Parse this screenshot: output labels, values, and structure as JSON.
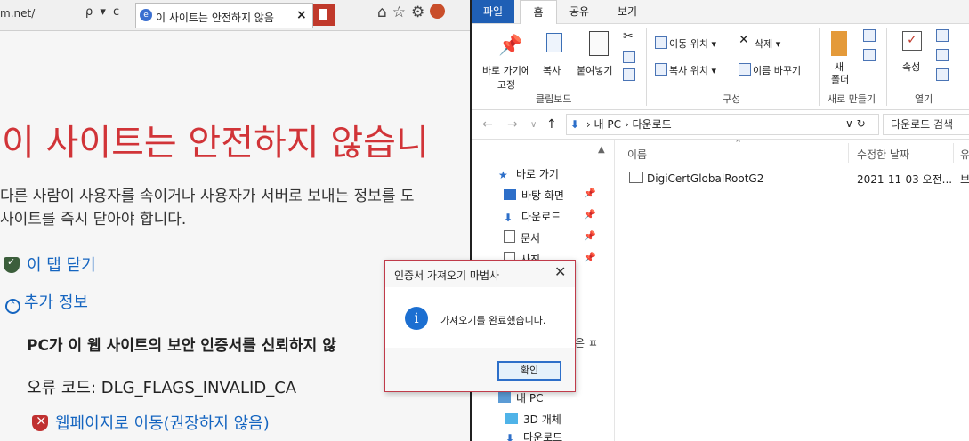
{
  "ie": {
    "url": "m.net/",
    "url_controls": "ρ ▾ c",
    "tab_title": "이 사이트는 안전하지 않음",
    "tab_close": "×",
    "tool_icons": [
      "home-icon",
      "star-icon",
      "gear-icon",
      "smiley-icon"
    ],
    "heading": "이 사이트는 안전하지 않습니",
    "desc_line1": "다른 사람이 사용자를 속이거나 사용자가 서버로 보내는 정보를 도",
    "desc_line2": "사이트를 즉시 닫아야 합니다.",
    "close_tab_link": "이 탭 닫기",
    "more_info_link": "추가 정보",
    "bold_text": "PC가 이 웹 사이트의 보안 인증서를 신뢰하지 않",
    "error_code": "오류 코드: DLG_FLAGS_INVALID_CA",
    "go_to_page_link": "웹페이지로 이동(권장하지 않음)"
  },
  "explorer": {
    "tabs": [
      "파일",
      "홈",
      "공유",
      "보기"
    ],
    "ribbon": {
      "pin_label": "바로 가기에\n고정",
      "copy": "복사",
      "paste": "붙여넣기",
      "clipboard_group": "클립보드",
      "move_to": "이동 위치 ▾",
      "copy_to": "복사 위치 ▾",
      "delete": "삭제 ▾",
      "rename": "이름 바꾸기",
      "organize_group": "구성",
      "new_folder_1": "새",
      "new_folder_2": "폴더",
      "new_group": "새로 만들기",
      "properties": "속성",
      "open_group": "열기"
    },
    "address": {
      "path_pc": "내 PC",
      "path_sep": "›",
      "path_folder": "다운로드",
      "search_placeholder": "다운로드 검색"
    },
    "nav": [
      {
        "label": "바로 가기",
        "pinned": false
      },
      {
        "label": "바탕 화면",
        "pinned": true
      },
      {
        "label": "다운로드",
        "pinned": true
      },
      {
        "label": "문서",
        "pinned": true
      },
      {
        "label": "사진",
        "pinned": true
      },
      {
        "label": "은 ㅍ",
        "pinned": false
      },
      {
        "label": "내 PC",
        "pinned": false
      },
      {
        "label": "3D 개체",
        "pinned": false
      },
      {
        "label": "다운로드",
        "pinned": false
      }
    ],
    "columns": [
      "이름",
      "수정한 날짜",
      "유"
    ],
    "files": [
      {
        "name": "DigiCertGlobalRootG2",
        "date": "2021-11-03 오전...",
        "type": "보"
      }
    ]
  },
  "dialog": {
    "title": "인증서 가져오기 마법사",
    "close": "✕",
    "message": "가져오기를 완료했습니다.",
    "ok": "확인"
  },
  "colors": {
    "warning_red": "#d13438",
    "link_blue": "#1565c0",
    "file_tab_blue": "#1f5fb5",
    "dialog_border": "#c03b4a"
  }
}
